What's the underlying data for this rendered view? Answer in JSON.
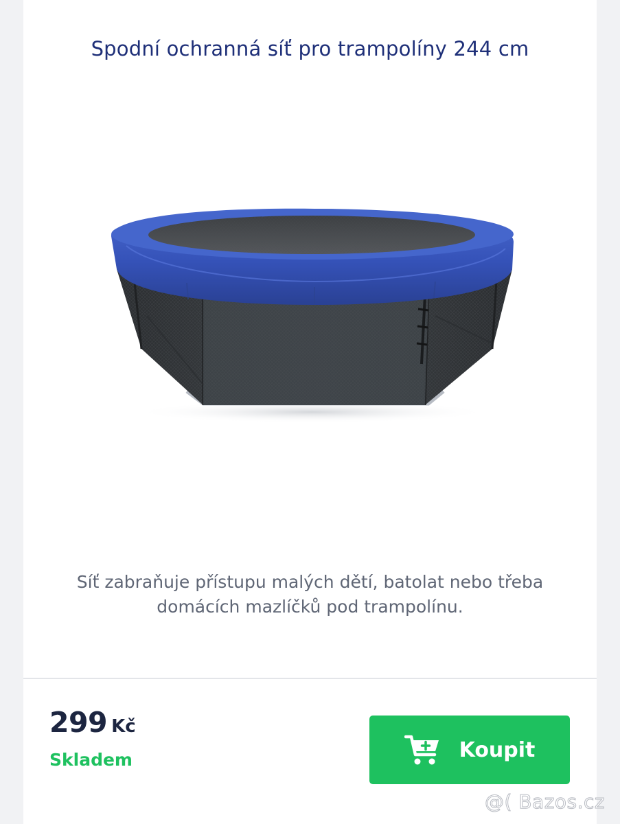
{
  "product": {
    "title": "Spodní ochranná síť pro trampolíny 244 cm",
    "image_icon": "trampoline-with-bottom-safety-net",
    "description": "Síť zabraňuje přístupu malých dětí, batolat nebo třeba domácích mazlíčků pod trampolínu.",
    "price": {
      "value": "299",
      "currency": "Kč"
    },
    "stock_status": "Skladem",
    "buy_button": {
      "label": "Koupit",
      "icon": "add-to-cart-icon"
    }
  },
  "watermark": {
    "text": "@( Bazos.cz"
  },
  "colors": {
    "title": "#1e2f78",
    "accent_green": "#1ec15f",
    "price_text": "#1c2540",
    "description_text": "#5f6675",
    "trampoline_pad_blue": "#3552b8",
    "background": "#f1f2f4"
  }
}
